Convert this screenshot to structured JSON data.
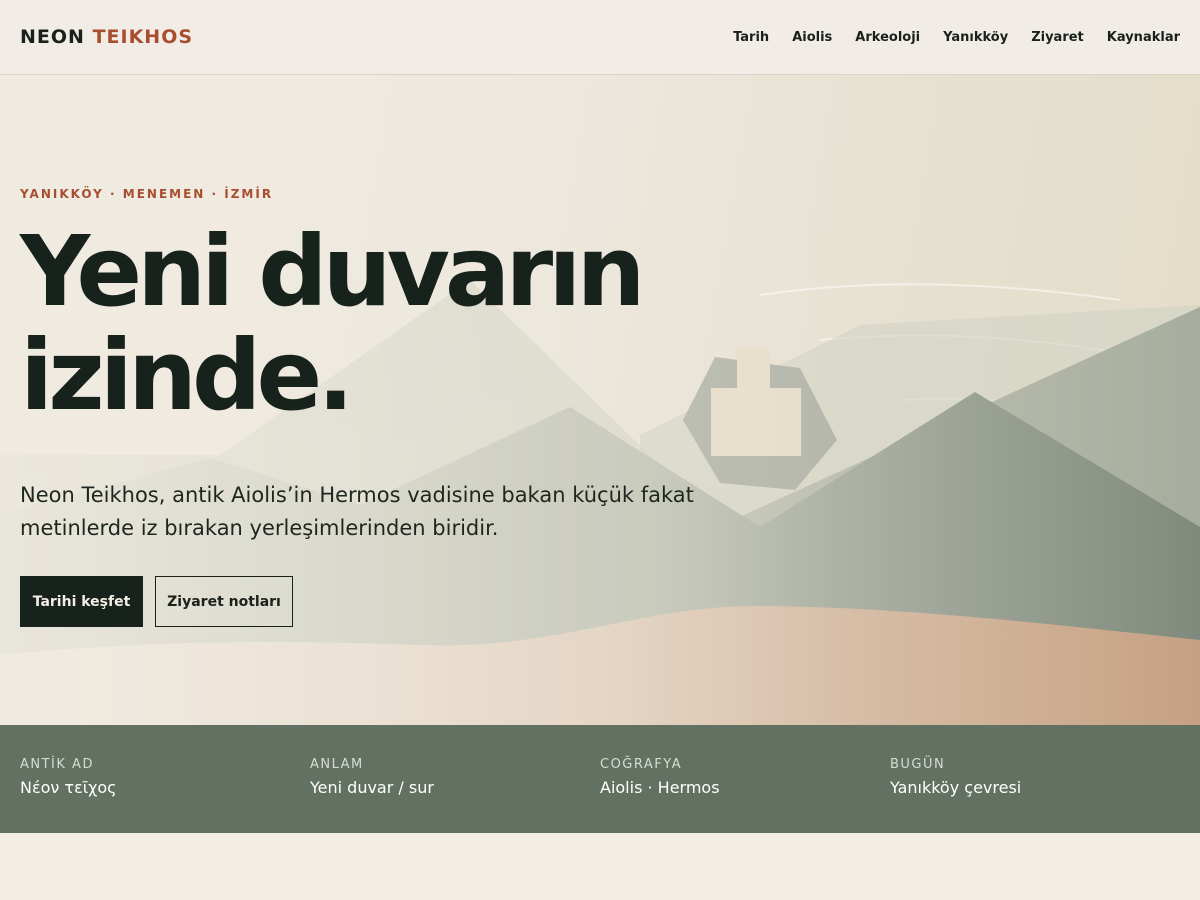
{
  "brand": {
    "part1": "NEON",
    "part2": "TEIKHOS"
  },
  "nav": [
    {
      "label": "Tarih"
    },
    {
      "label": "Aiolis"
    },
    {
      "label": "Arkeoloji"
    },
    {
      "label": "Yanıkköy"
    },
    {
      "label": "Ziyaret"
    },
    {
      "label": "Kaynaklar"
    }
  ],
  "hero": {
    "eyebrow": "YANIKKÖY · MENEMEN · İZMİR",
    "title_line1": "Yeni duvarın",
    "title_line2": "izinde.",
    "description": "Neon Teikhos, antik Aiolis’in Hermos vadisine bakan küçük fakat metinlerde iz bırakan yerleşimlerinden biridir.",
    "primary_button": "Tarihi keşfet",
    "secondary_button": "Ziyaret notları"
  },
  "facts": [
    {
      "label": "ANTİK AD",
      "value": "Νέον τεῖχος"
    },
    {
      "label": "ANLAM",
      "value": "Yeni duvar / sur"
    },
    {
      "label": "COĞRAFYA",
      "value": "Aiolis · Hermos"
    },
    {
      "label": "BUGÜN",
      "value": "Yanıkköy çevresi"
    }
  ],
  "colors": {
    "accent": "#a74e30",
    "dark": "#18221c",
    "band": "#637163",
    "background": "#f2eee5"
  }
}
